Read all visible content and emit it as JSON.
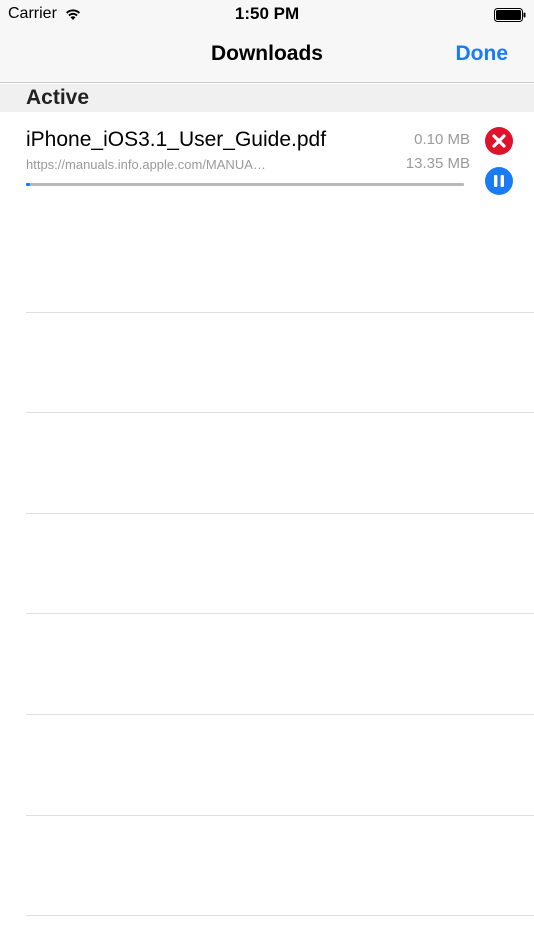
{
  "status_bar": {
    "carrier": "Carrier",
    "time": "1:50 PM",
    "wifi_icon": "wifi-icon",
    "battery_icon": "battery-icon"
  },
  "nav": {
    "title": "Downloads",
    "done_label": "Done"
  },
  "section": {
    "title": "Active"
  },
  "downloads": [
    {
      "file_name": "iPhone_iOS3.1_User_Guide.pdf",
      "url": "https://manuals.info.apple.com/MANUA…",
      "downloaded": "0.10 MB",
      "total": "13.35 MB",
      "progress_fraction": 0.01,
      "cancel_icon": "close-circle-icon",
      "pause_icon": "pause-circle-icon"
    }
  ],
  "colors": {
    "accent": "#1a7cf5",
    "cancel": "#e0112b",
    "progress_track": "#b8b8b8",
    "nav_background": "#f7f7f7",
    "section_background": "#f0f0f0"
  }
}
